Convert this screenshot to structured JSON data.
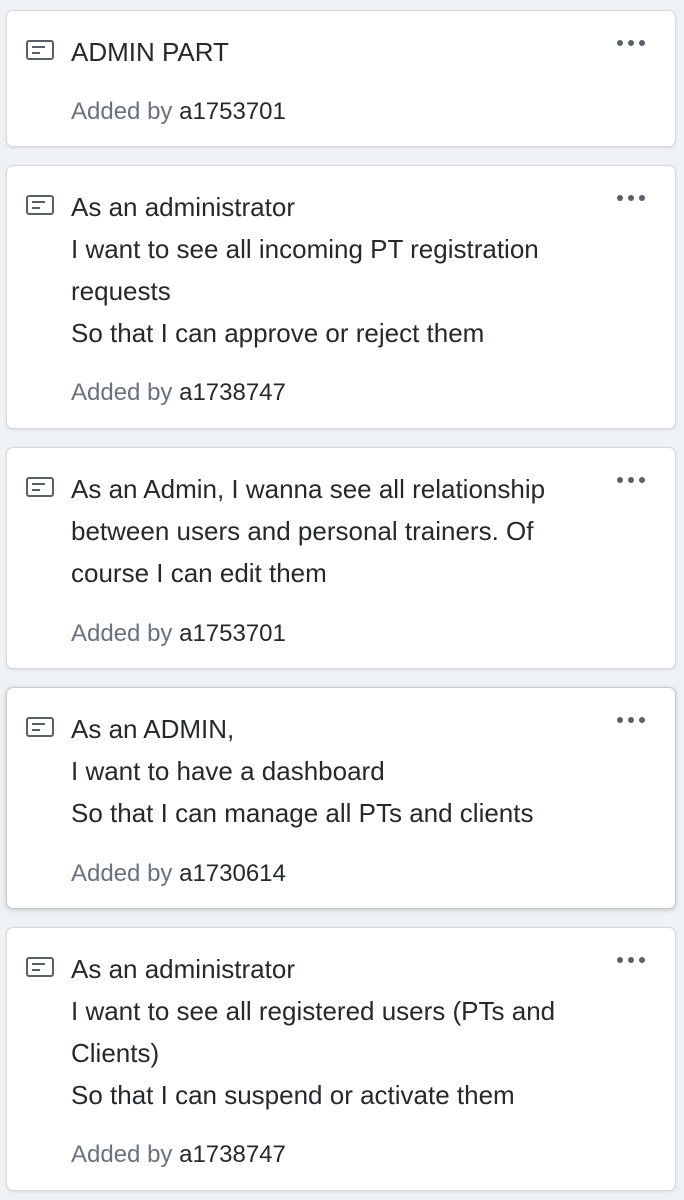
{
  "cards": [
    {
      "lines": [
        "ADMIN PART"
      ],
      "added_label": "Added by",
      "author": "a1753701"
    },
    {
      "lines": [
        "As an administrator",
        "I want to see all incoming PT registration",
        "requests",
        "So that I can approve or reject them"
      ],
      "added_label": "Added by",
      "author": "a1738747"
    },
    {
      "lines": [
        "As an Admin, I wanna see all relationship",
        "between users and personal trainers. Of",
        "course I can edit them"
      ],
      "added_label": "Added by",
      "author": "a1753701"
    },
    {
      "lines": [
        "As an ADMIN,",
        "I want to have a dashboard",
        "So that I can manage all PTs and clients"
      ],
      "added_label": "Added by",
      "author": "a1730614"
    },
    {
      "lines": [
        "As an administrator",
        "I want to see all registered users (PTs and",
        "Clients)",
        "So that I can suspend or activate them"
      ],
      "added_label": "Added by",
      "author": "a1738747"
    }
  ],
  "colors": {
    "background": "#eff2f5",
    "card": "#ffffff",
    "text": "#24292e",
    "muted": "#6a737d"
  },
  "icons": {
    "note": "note-icon",
    "menu": "kebab-menu-icon"
  }
}
